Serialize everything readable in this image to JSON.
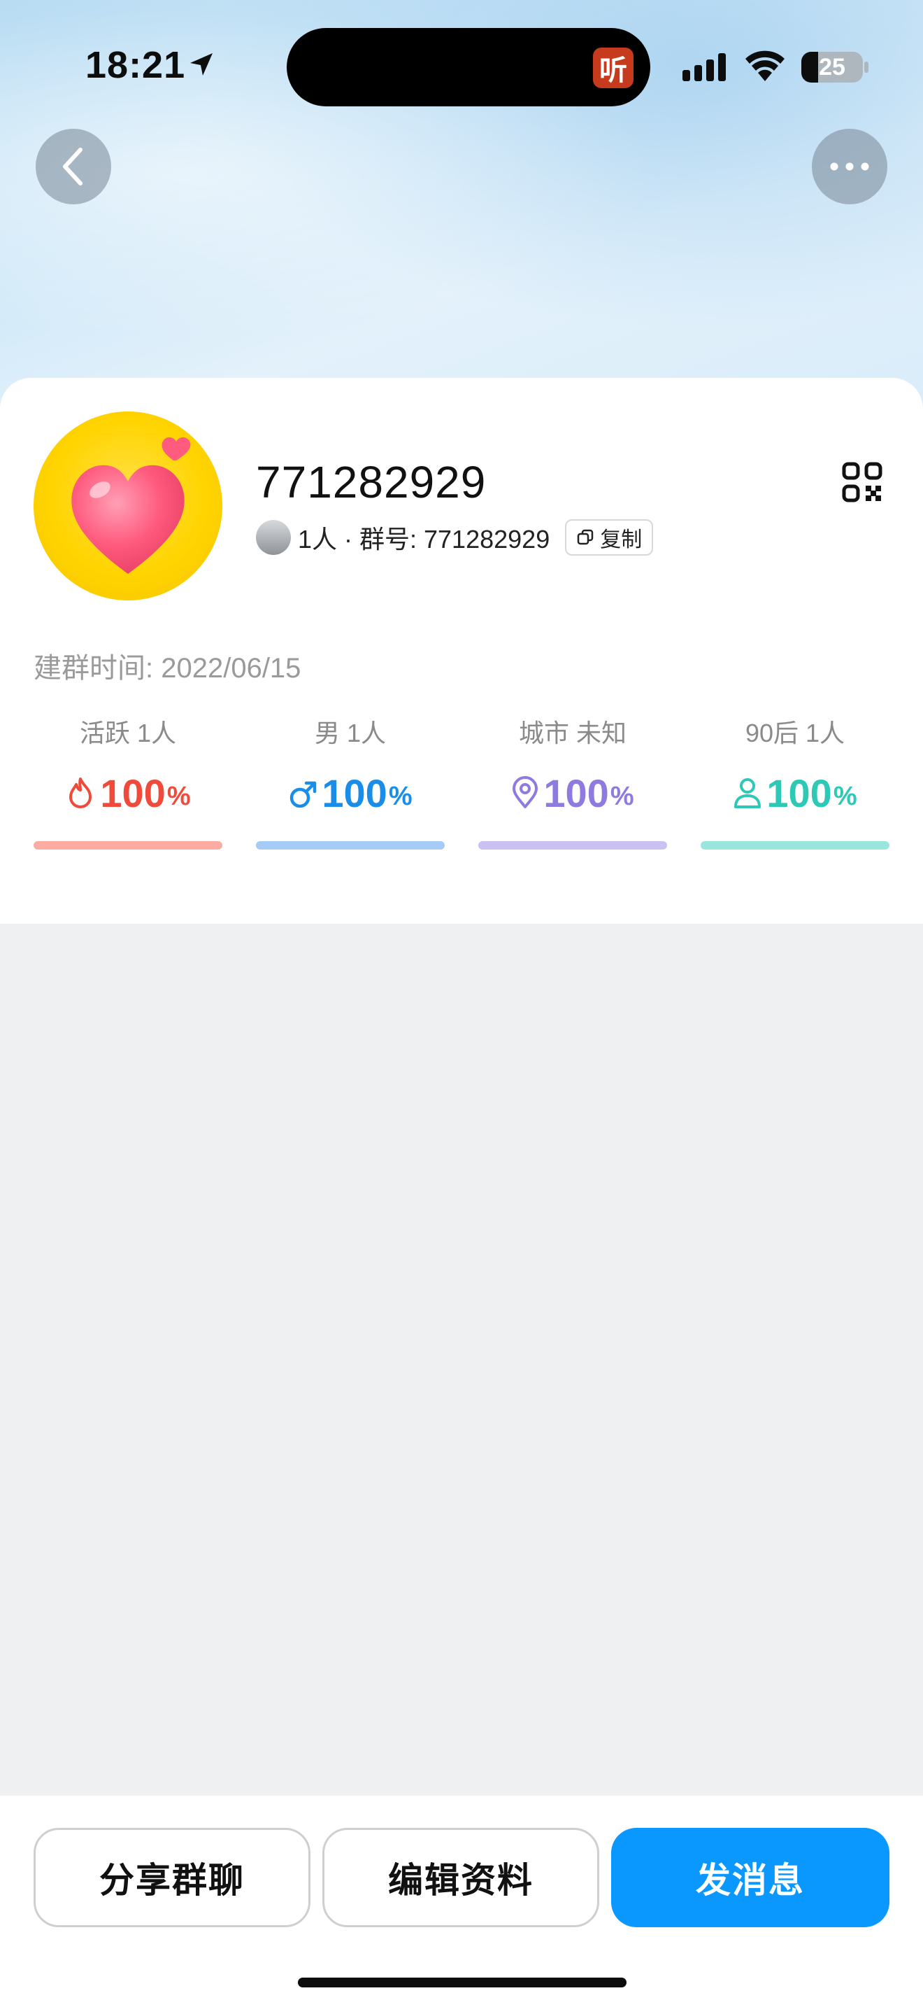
{
  "status_bar": {
    "time": "18:21",
    "island_app_label": "听",
    "battery_level": "25"
  },
  "header": {
    "back_icon": "chevron-left-icon",
    "more_icon": "more-icon"
  },
  "group": {
    "name": "771282929",
    "meta": "1人 · 群号: 771282929",
    "copy_label": "复制",
    "created": "建群时间: 2022/06/15"
  },
  "stats": [
    {
      "label": "活跃 1人",
      "value": "100",
      "unit": "%",
      "color": "#f04a3a",
      "bar_color": "#fcaca2",
      "icon": "flame-icon"
    },
    {
      "label": "男 1人",
      "value": "100",
      "unit": "%",
      "color": "#1a8de8",
      "bar_color": "#a6cbf6",
      "icon": "male-icon"
    },
    {
      "label": "城市 未知",
      "value": "100",
      "unit": "%",
      "color": "#8f7ae0",
      "bar_color": "#cbc1f2",
      "icon": "location-icon"
    },
    {
      "label": "90后 1人",
      "value": "100",
      "unit": "%",
      "color": "#2ec8b6",
      "bar_color": "#9ae6dc",
      "icon": "person-icon"
    }
  ],
  "actions": {
    "share": "分享群聊",
    "edit": "编辑资料",
    "message": "发消息"
  },
  "colors": {
    "primary": "#0a98ff",
    "avatar_yellow": "#ffd400",
    "heart": "#ff5b7e"
  }
}
